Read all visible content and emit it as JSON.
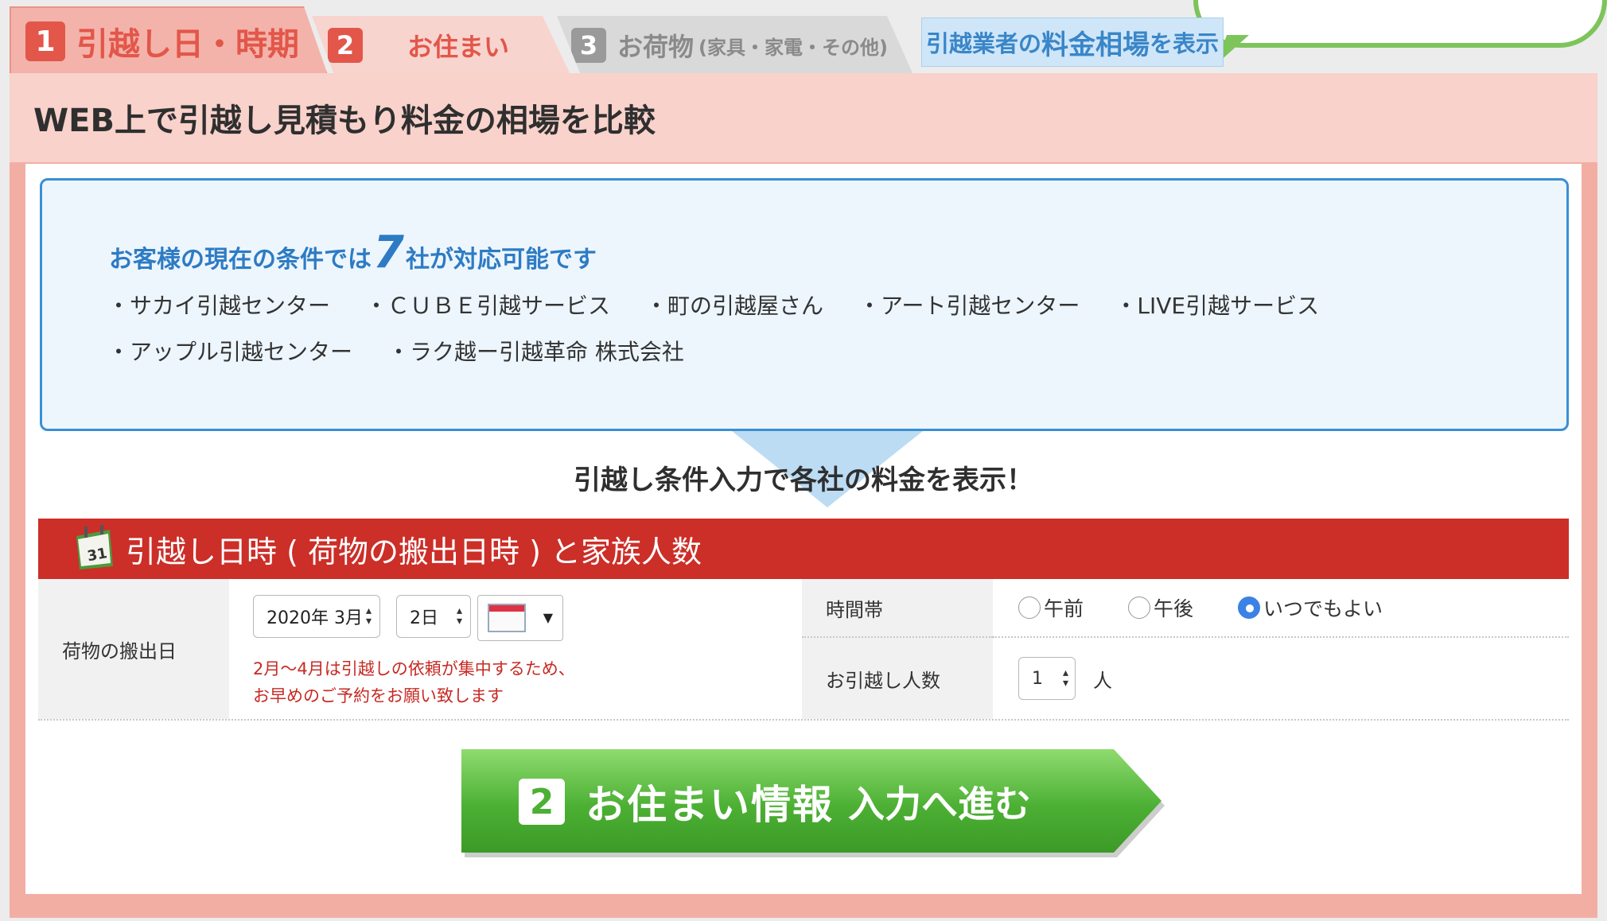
{
  "tabs": {
    "tab1": {
      "num": "1",
      "label": "引越し日・時期"
    },
    "tab2": {
      "num": "2",
      "label": "お住まい"
    },
    "tab3": {
      "num": "3",
      "label": "お荷物",
      "sub": "(家具・家電・その他)"
    },
    "tab4": {
      "prefix": "引越業者の",
      "big": "料金相場",
      "suffix": "を表示"
    }
  },
  "bubble": {
    "text": "…"
  },
  "page": {
    "heading": "WEB上で引越し見積もり料金の相場を比較"
  },
  "info": {
    "headline_pre": "お客様の現在の条件では",
    "count": "7",
    "headline_post": "社が対応可能です",
    "companies": [
      "・サカイ引越センター",
      "・ＣＵＢＥ引越サービス",
      "・町の引越屋さん",
      "・アート引越センター",
      "・LIVE引越サービス",
      "・アップル引越センター",
      "・ラク越ー引越革命 株式会社"
    ]
  },
  "arrow_text": "引越し条件入力で各社の料金を表示！",
  "section": {
    "title": "引越し日時 ( 荷物の搬出日時 ) と家族人数",
    "icon_day": "31"
  },
  "form": {
    "date_label": "荷物の搬出日",
    "year_month": "2020年 3月",
    "day": "2日",
    "note_line1": "2月～4月は引越しの依頼が集中するため、",
    "note_line2": "お早めのご予約をお願い致します",
    "time_label": "時間帯",
    "time_options": [
      "午前",
      "午後",
      "いつでもよい"
    ],
    "time_selected": "いつでもよい",
    "people_label": "お引越し人数",
    "people_value": "1",
    "people_unit": "人"
  },
  "next_button": {
    "num": "2",
    "label": "お住まい情報",
    "label2": "入力へ進む"
  },
  "colors": {
    "accent_red": "#cc2e28",
    "tab_pink": "#f3b3aa",
    "info_blue": "#3a8fd3",
    "button_green": "#4cb034"
  }
}
